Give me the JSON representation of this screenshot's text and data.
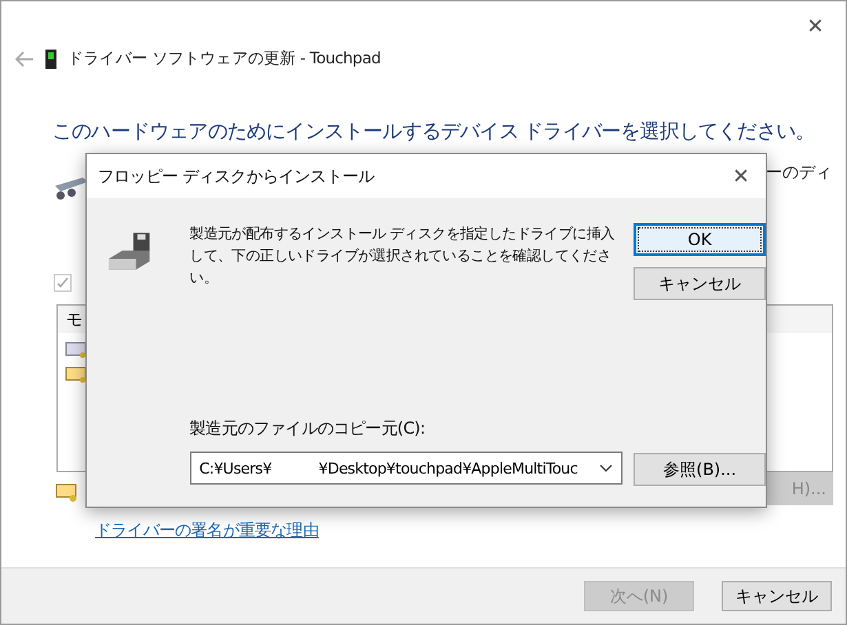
{
  "window": {
    "title": "ドライバー ソフトウェアの更新 - Touchpad",
    "close": "✕"
  },
  "heading": "このハードウェアのためにインストールするデバイス ドライバーを選択してください。",
  "partial_text": "ーのディ",
  "checkbox": {
    "checked": true,
    "disabled": true
  },
  "list": {
    "header": "モ"
  },
  "partial_button": {
    "label": "H)...",
    "disabled": true
  },
  "link": "ドライバーの署名が重要な理由",
  "footer_buttons": [
    {
      "label": "次へ(N)",
      "disabled": true
    },
    {
      "label": "キャンセル",
      "disabled": false
    }
  ],
  "dialog": {
    "title": "フロッピー ディスクからインストール",
    "close": "✕",
    "message": "製造元が配布するインストール ディスクを指定したドライブに挿入して、下の正しいドライブが選択されていることを確認してください。",
    "buttons": [
      {
        "label": "OK",
        "default": true
      },
      {
        "label": "キャンセル",
        "default": false
      }
    ],
    "path_label": "製造元のファイルのコピー元(C):",
    "path_value": "C:¥Users¥           ¥Desktop¥touchpad¥AppleMultiTouc",
    "browse": "参照(B)..."
  }
}
